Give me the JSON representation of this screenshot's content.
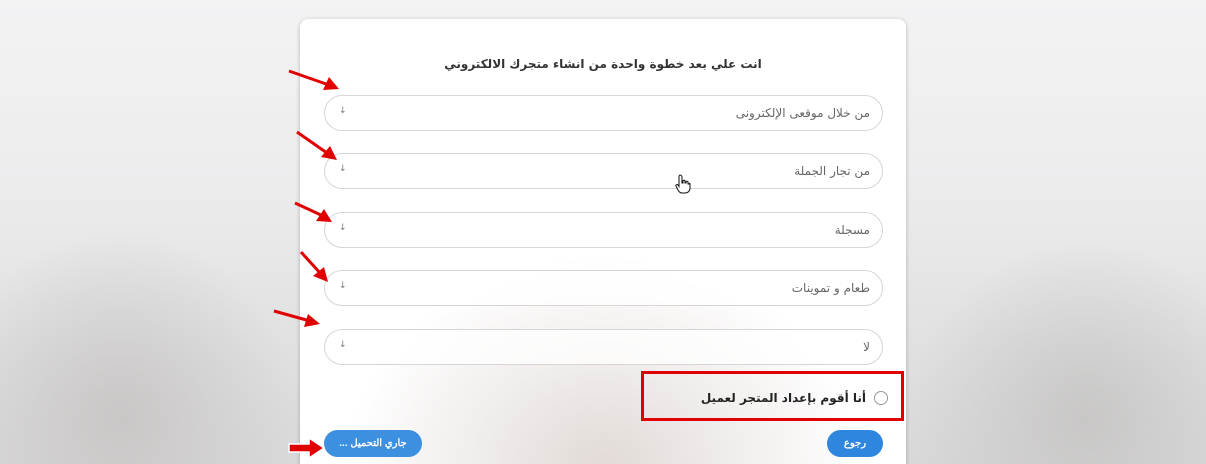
{
  "form": {
    "title": "انت علي بعد خطوة واحدة من انشاء متجرك الالكتروني",
    "selects": [
      {
        "value": "من خلال موقعى الإلكترونى"
      },
      {
        "value": "من تجار الجملة"
      },
      {
        "value": "مسجلة"
      },
      {
        "value": "طعام و تموينات"
      },
      {
        "value": "لا"
      }
    ],
    "select_arrow": "↓",
    "checkbox_label": "أنا أقوم بإعداد المتجر لعميل",
    "loading_button": "جاري التحميل ...",
    "back_button": "رجوع"
  },
  "colors": {
    "annotation": "#e00000",
    "button": "#2e86de"
  },
  "icons": [
    "select-arrow-icon",
    "hand-cursor-icon",
    "red-annotation-arrow-icon"
  ]
}
